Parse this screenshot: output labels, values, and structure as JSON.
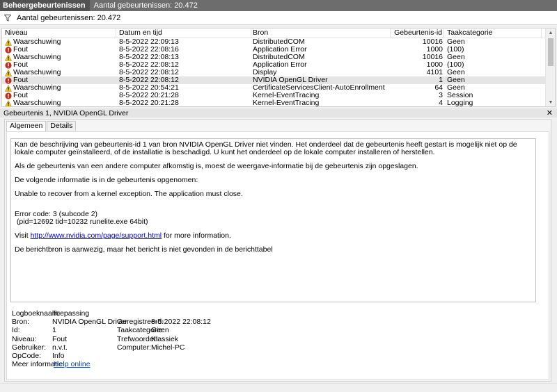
{
  "titlebar": {
    "title": "Beheergebeurtenissen",
    "count_text": "Aantal gebeurtenissen: 20.472"
  },
  "filter": {
    "icon": "filter-icon",
    "text": "Aantal gebeurtenissen: 20.472"
  },
  "columns": {
    "level": "Niveau",
    "date": "Datum en tijd",
    "source": "Bron",
    "id": "Gebeurtenis-id",
    "category": "Taakcategorie"
  },
  "events": [
    {
      "level": "Waarschuwing",
      "type": "warning",
      "date": "8-5-2022 22:09:13",
      "source": "DistributedCOM",
      "id": "10016",
      "category": "Geen"
    },
    {
      "level": "Fout",
      "type": "error",
      "date": "8-5-2022 22:08:16",
      "source": "Application Error",
      "id": "1000",
      "category": "(100)"
    },
    {
      "level": "Waarschuwing",
      "type": "warning",
      "date": "8-5-2022 22:08:13",
      "source": "DistributedCOM",
      "id": "10016",
      "category": "Geen"
    },
    {
      "level": "Fout",
      "type": "error",
      "date": "8-5-2022 22:08:12",
      "source": "Application Error",
      "id": "1000",
      "category": "(100)"
    },
    {
      "level": "Waarschuwing",
      "type": "warning",
      "date": "8-5-2022 22:08:12",
      "source": "Display",
      "id": "4101",
      "category": "Geen"
    },
    {
      "level": "Fout",
      "type": "error",
      "date": "8-5-2022 22:08:12",
      "source": "NVIDIA OpenGL Driver",
      "id": "1",
      "category": "Geen",
      "selected": true
    },
    {
      "level": "Waarschuwing",
      "type": "warning",
      "date": "8-5-2022 20:54:21",
      "source": "CertificateServicesClient-AutoEnrollment",
      "id": "64",
      "category": "Geen"
    },
    {
      "level": "Fout",
      "type": "error",
      "date": "8-5-2022 20:21:28",
      "source": "Kernel-EventTracing",
      "id": "3",
      "category": "Session"
    },
    {
      "level": "Waarschuwing",
      "type": "warning",
      "date": "8-5-2022 20:21:28",
      "source": "Kernel-EventTracing",
      "id": "4",
      "category": "Logging"
    }
  ],
  "detail": {
    "title": "Gebeurtenis 1, NVIDIA OpenGL Driver",
    "close": "✕",
    "tabs": [
      "Algemeen",
      "Details"
    ],
    "message": {
      "p1": "Kan de beschrijving van gebeurtenis-id 1 van bron NVIDIA OpenGL Driver niet vinden. Het onderdeel dat de gebeurtenis heeft gestart is mogelijk niet op de lokale computer geïnstalleerd, of de installatie is beschadigd. U kunt het onderdeel op de lokale computer installeren of herstellen.",
      "p2": "Als de gebeurtenis van een andere computer afkomstig is, moest de weergave-informatie bij de gebeurtenis zijn opgeslagen.",
      "p3": "De volgende informatie is in de gebeurtenis opgenomen:",
      "p4": "Unable to recover from a kernel exception. The application must close.",
      "p5a": "Error code: 3 (subcode 2)",
      "p5b": " (pid=12692 tid=10232 runelite.exe 64bit)",
      "p6_pre": "Visit ",
      "p6_link": "http://www.nvidia.com/page/support.html",
      "p6_post": " for more information.",
      "p7": "De berichtbron is aanwezig, maar het bericht is niet gevonden in de berichttabel"
    },
    "props": {
      "logname_label": "Logboeknaam:",
      "logname": "Toepassing",
      "source_label": "Bron:",
      "source": "NVIDIA OpenGL Driver",
      "logged_label": "Geregistreerd:",
      "logged": "8-5-2022 22:08:12",
      "id_label": "Id:",
      "id": "1",
      "taskcat_label": "Taakcategorie:",
      "taskcat": "Geen",
      "level_label": "Niveau:",
      "level": "Fout",
      "keywords_label": "Trefwoorden:",
      "keywords": "Klassiek",
      "user_label": "Gebruiker:",
      "user": "n.v.t.",
      "computer_label": "Computer:",
      "computer": "Michel-PC",
      "opcode_label": "OpCode:",
      "opcode": "Info",
      "moreinfo_label": "Meer informatie:",
      "moreinfo": "Help online"
    }
  },
  "colors": {
    "error": "#c42b1c",
    "warning": "#f2c811",
    "link": "#0000ee"
  }
}
